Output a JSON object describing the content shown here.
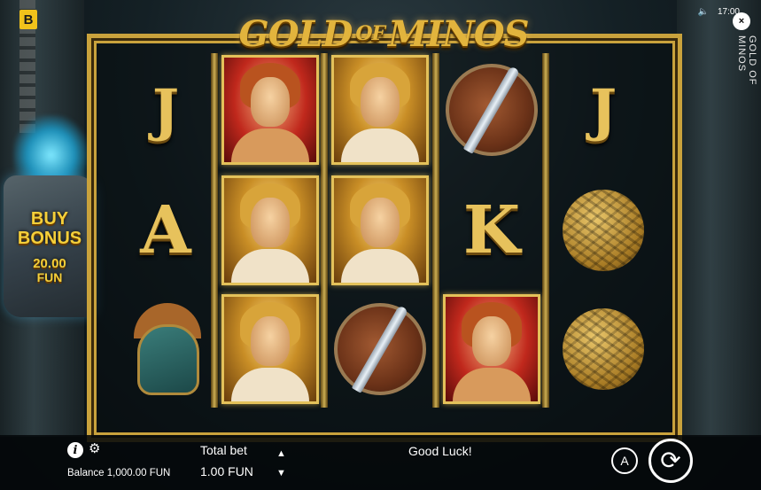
{
  "brand": {
    "badge": "B"
  },
  "game": {
    "title_word1": "GOLD",
    "title_word2": "OF",
    "title_word3": "MINOS",
    "vertical_title": "GOLD OF MINOS"
  },
  "status_bar": {
    "time": "17:00",
    "sound_icon": "speaker-icon",
    "close_label": "×"
  },
  "buy_bonus": {
    "line1": "BUY",
    "line2": "BONUS",
    "price": "20.00",
    "currency": "FUN"
  },
  "reels": {
    "columns": [
      [
        "J",
        "A",
        "helmet"
      ],
      [
        "lady",
        "hero",
        "hero"
      ],
      [
        "hero",
        "hero",
        "shield"
      ],
      [
        "shield",
        "K",
        "lady"
      ],
      [
        "J",
        "ball",
        "ball"
      ]
    ]
  },
  "bottom": {
    "info_icon": "i",
    "settings_icon": "gear-icon",
    "balance": "Balance 1,000.00 FUN",
    "total_bet_label": "Total bet",
    "total_bet_value": "1.00 FUN",
    "bet_up": "▲",
    "bet_down": "▼",
    "message": "Good Luck!",
    "autoplay_label": "A",
    "spin_icon": "spin-icon"
  },
  "colors": {
    "gold": "#c9a23c",
    "badge": "#f1c21b",
    "bonus_text": "#f4cf3a"
  }
}
